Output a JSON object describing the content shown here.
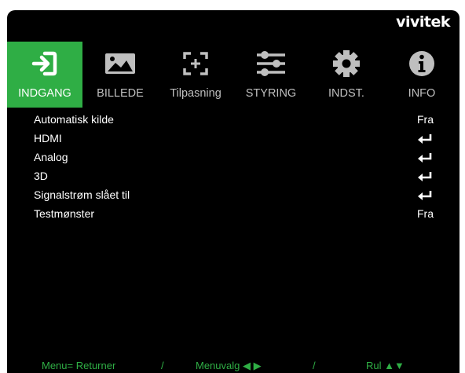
{
  "brand": {
    "logo": "vivitek"
  },
  "tabs": [
    {
      "label": "INDGANG",
      "icon": "input-arrow-icon",
      "active": true
    },
    {
      "label": "BILLEDE",
      "icon": "picture-icon",
      "active": false
    },
    {
      "label": "Tilpasning",
      "icon": "display-adjust-icon",
      "active": false
    },
    {
      "label": "STYRING",
      "icon": "sliders-icon",
      "active": false
    },
    {
      "label": "INDST.",
      "icon": "gear-icon",
      "active": false
    },
    {
      "label": "INFO",
      "icon": "info-icon",
      "active": false
    }
  ],
  "menu": {
    "items": [
      {
        "label": "Automatisk kilde",
        "value": "Fra"
      },
      {
        "label": "HDMI",
        "value": ""
      },
      {
        "label": "Analog",
        "value": ""
      },
      {
        "label": "3D",
        "value": ""
      },
      {
        "label": "Signalstrøm slået til",
        "value": ""
      },
      {
        "label": "Testmønster",
        "value": "Fra"
      }
    ]
  },
  "footer": {
    "menu_hint": "Menu= Returner",
    "sep1": "/",
    "select_hint": "Menuvalg",
    "sep2": "/",
    "scroll_hint": "Rul"
  },
  "colors": {
    "accent": "#2fae45",
    "background": "#000000",
    "text": "#ffffff",
    "inactive_label": "#bfbfbf"
  }
}
